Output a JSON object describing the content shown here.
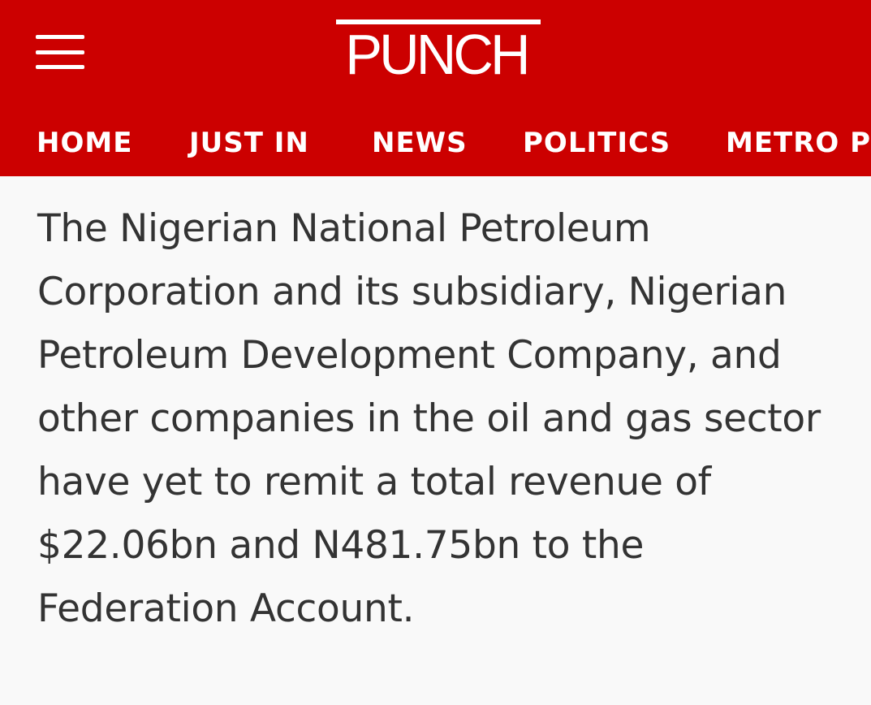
{
  "header": {
    "logo_text": "PUNCH",
    "menu_icon": "hamburger-menu-icon",
    "background_color": "#cc0000"
  },
  "nav": {
    "items": [
      {
        "label": "HOME"
      },
      {
        "label": "JUST IN"
      },
      {
        "label": "NEWS"
      },
      {
        "label": "POLITICS"
      },
      {
        "label": "METRO P"
      }
    ]
  },
  "article": {
    "paragraph": "The Nigerian National Petroleum Corporation and its subsidiary, Nigerian Petroleum Development Company, and other companies in the oil and gas sector have yet to remit a total revenue of $22.06bn and N481.75bn to the Federation Account."
  }
}
